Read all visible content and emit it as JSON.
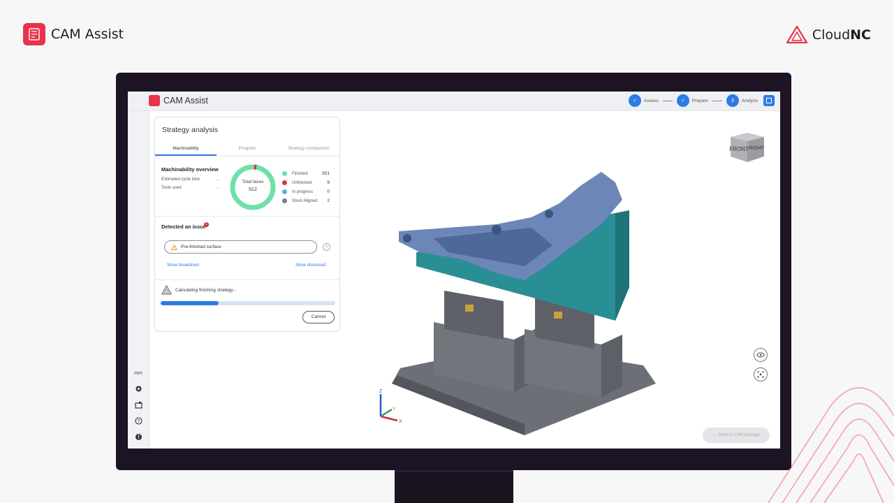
{
  "outer": {
    "brand_name": "CAM Assist",
    "cloudnc_prefix": "Cloud",
    "cloudnc_suffix": "NC",
    "accent": "#e8334a"
  },
  "app": {
    "title": "CAM Assist",
    "steps": [
      {
        "label": "Assess",
        "icon": "check-icon"
      },
      {
        "label": "Prepare",
        "icon": "check-icon"
      },
      {
        "number": "3",
        "label": "Analyze"
      }
    ],
    "units": "mm",
    "rail_icons": [
      "settings-icon",
      "machine-icon",
      "help-icon",
      "alert-icon"
    ]
  },
  "panel": {
    "title": "Strategy analysis",
    "tabs": [
      "Machinability",
      "Program",
      "Strategy comparison"
    ],
    "active_tab": "Machinability",
    "overview": {
      "title": "Machinability overview",
      "rows": [
        {
          "label": "Estimated cycle time",
          "value": "..."
        },
        {
          "label": "Tools used",
          "value": "..."
        }
      ],
      "donut_label": "Total faces",
      "donut_value": "512",
      "legend": [
        {
          "name": "Finished",
          "count": "501",
          "color": "#6fe0a8"
        },
        {
          "name": "Unfinished",
          "count": "9",
          "color": "#e0353a"
        },
        {
          "name": "In progress",
          "count": "0",
          "color": "#5aaee8"
        },
        {
          "name": "Stock Aligned",
          "count": "2",
          "color": "#7a7d85"
        }
      ]
    },
    "issue": {
      "title": "Detected an issue",
      "badge": "1",
      "pill_text": "Pre-finished surface",
      "show_breakdown": "Show breakdown",
      "show_dismissed": "Show dismissed"
    },
    "calc": {
      "text": "Calculating finishing strategy...",
      "progress": 0.33,
      "cancel": "Cancel"
    }
  },
  "viewport": {
    "cube_front": "FRONT",
    "cube_right": "RIGHT",
    "send_label": "Send to CAM package",
    "axis_z": "Z",
    "axis_y": "Y",
    "axis_x": "X"
  }
}
